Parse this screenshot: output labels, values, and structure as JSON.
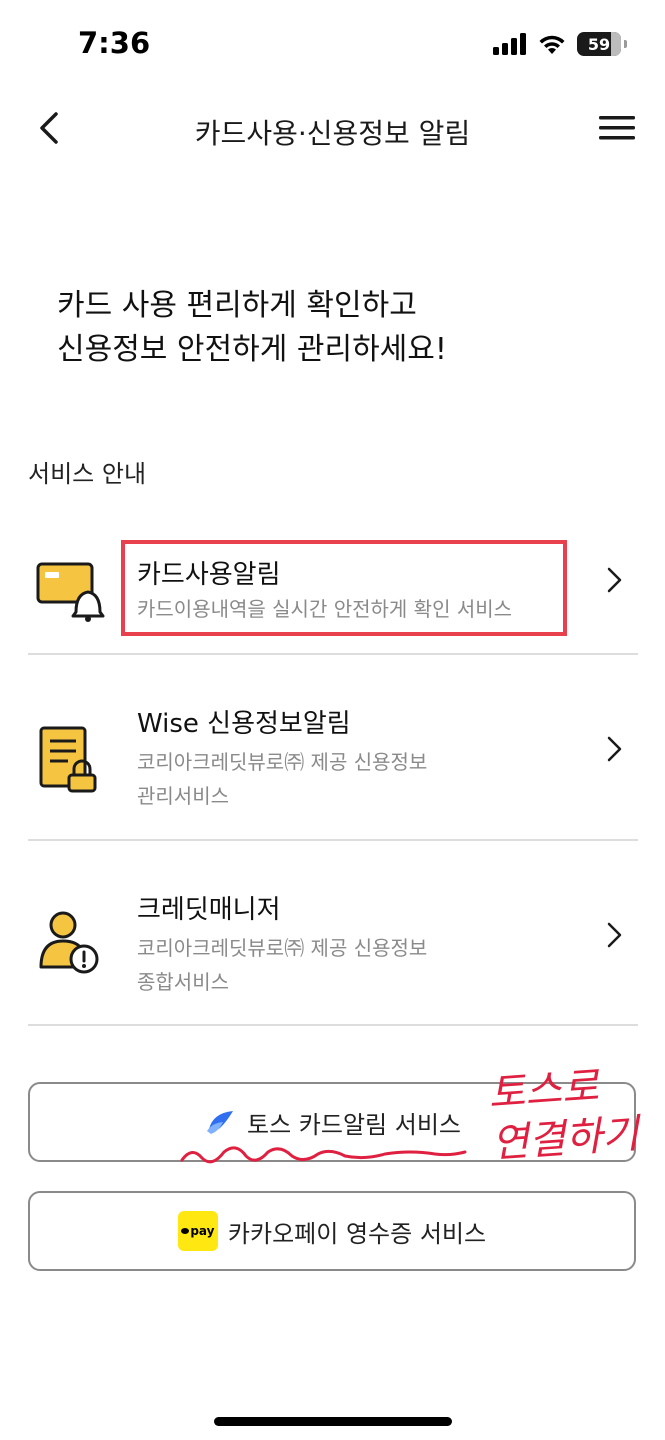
{
  "status_bar": {
    "time": "7:36",
    "battery": "59"
  },
  "nav": {
    "title": "카드사용·신용정보 알림"
  },
  "headline": {
    "line1": "카드 사용 편리하게 확인하고",
    "line2": "신용정보 안전하게 관리하세요!"
  },
  "section_label": "서비스 안내",
  "services": [
    {
      "title": "카드사용알림",
      "desc1": "카드이용내역을 실시간 안전하게 확인 서비스",
      "desc2": ""
    },
    {
      "title": "Wise 신용정보알림",
      "desc1": "코리아크레딧뷰로㈜ 제공 신용정보",
      "desc2": "관리서비스"
    },
    {
      "title": "크레딧매니저",
      "desc1": "코리아크레딧뷰로㈜ 제공 신용정보",
      "desc2": "종합서비스"
    }
  ],
  "buttons": {
    "toss": "토스 카드알림 서비스",
    "kakao": "카카오페이 영수증 서비스",
    "kakao_logo": "pay"
  },
  "annotation": {
    "line1": "토스로",
    "line2": "연결하기"
  },
  "colors": {
    "accent_yellow": "#f5c542",
    "highlight_red": "#e8404d",
    "toss_blue": "#2f6ff0",
    "kakao_yellow": "#ffe812"
  }
}
